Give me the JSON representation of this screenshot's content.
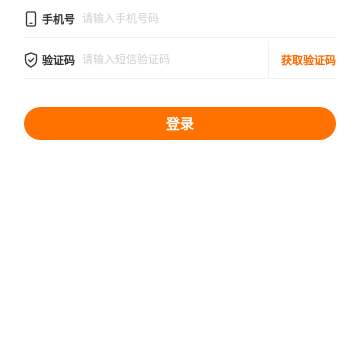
{
  "form": {
    "phone": {
      "icon": "phone-icon",
      "label": "手机号",
      "placeholder": "请输入手机号码",
      "value": ""
    },
    "code": {
      "icon": "shield-check-icon",
      "label": "验证码",
      "placeholder": "请输入短信验证码",
      "value": "",
      "get_code_label": "获取验证码"
    },
    "login_label": "登录"
  },
  "colors": {
    "accent": "#ff6a00",
    "button": "#ff7200",
    "placeholder": "#cfcfcf",
    "divider": "#f1f1f1"
  }
}
